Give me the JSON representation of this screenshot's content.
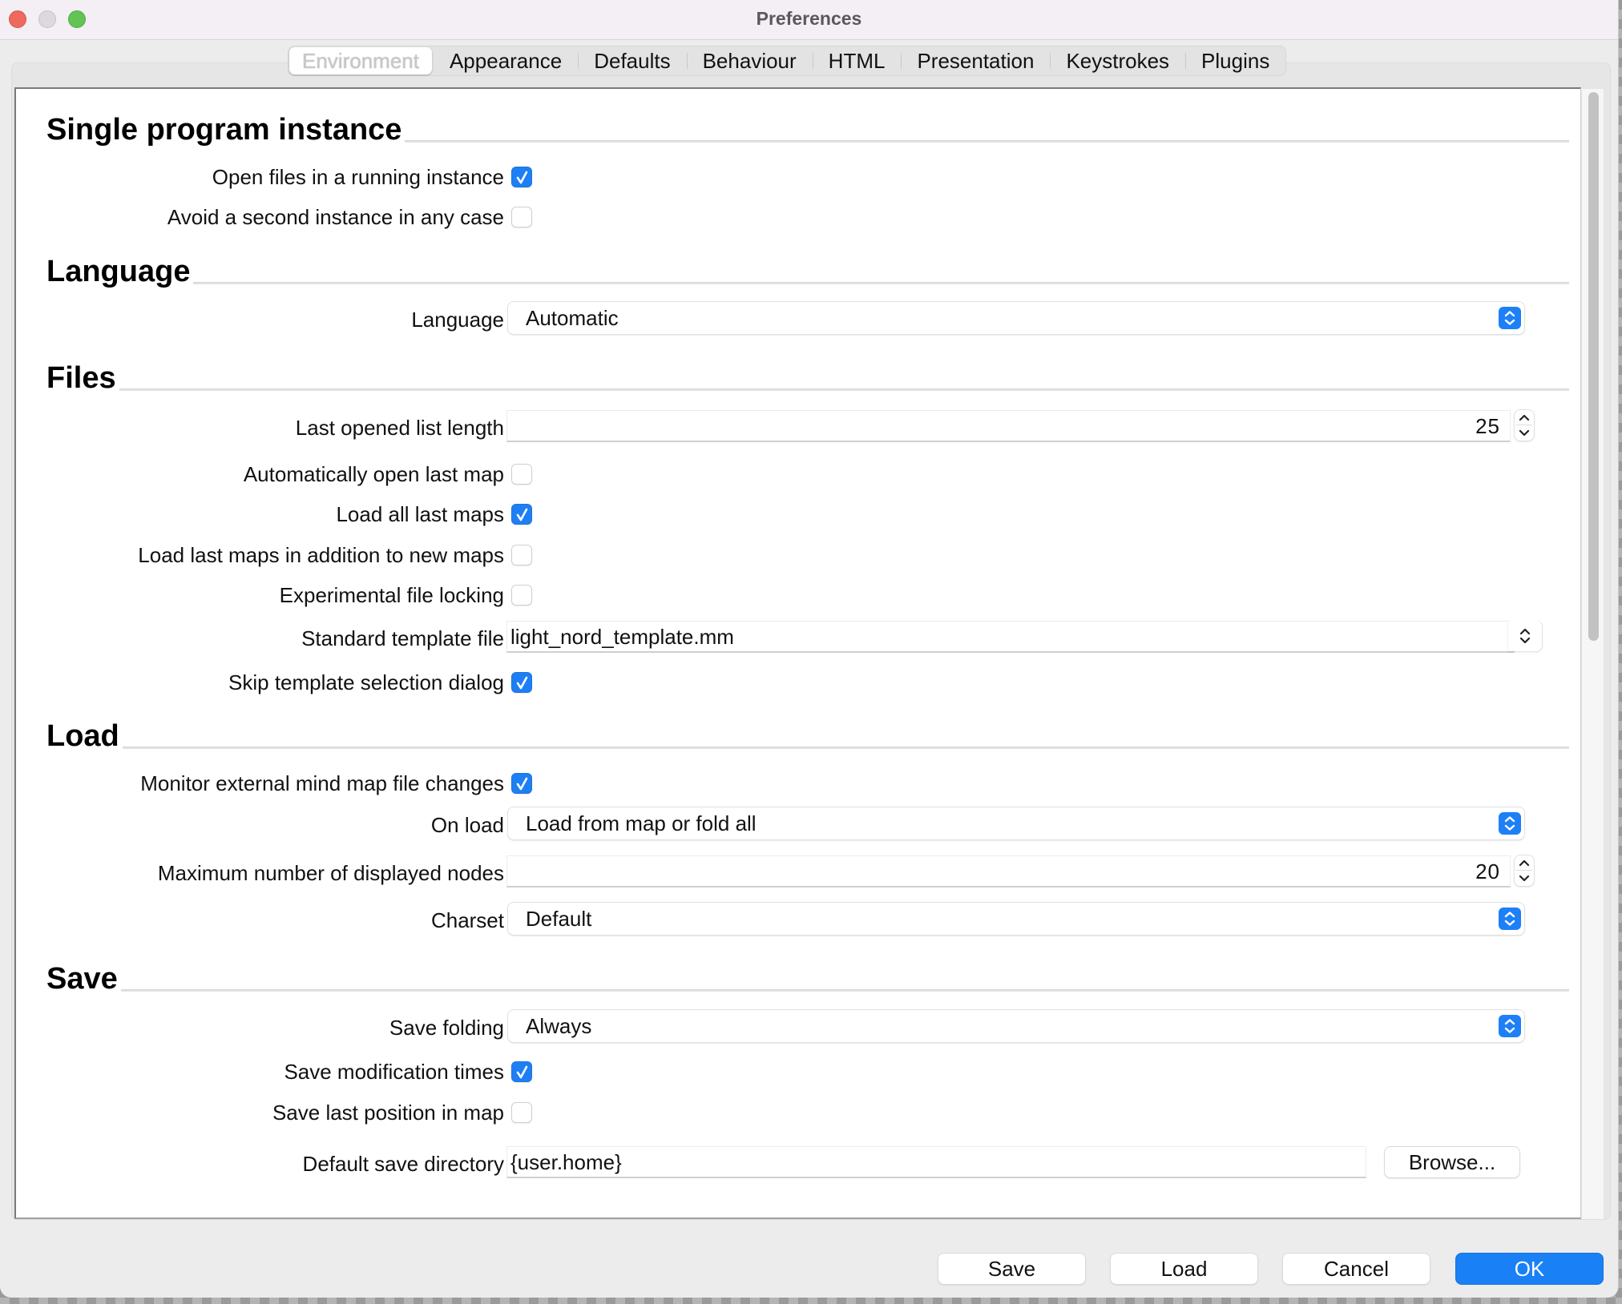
{
  "window": {
    "title": "Preferences"
  },
  "tabs": [
    {
      "label": "Environment",
      "active": true
    },
    {
      "label": "Appearance"
    },
    {
      "label": "Defaults"
    },
    {
      "label": "Behaviour"
    },
    {
      "label": "HTML"
    },
    {
      "label": "Presentation"
    },
    {
      "label": "Keystrokes"
    },
    {
      "label": "Plugins"
    }
  ],
  "sections": {
    "single_instance": {
      "title": "Single program instance",
      "open_files_running": {
        "label": "Open files in a running instance",
        "checked": true
      },
      "avoid_second": {
        "label": "Avoid a second instance in any case",
        "checked": false
      }
    },
    "language": {
      "title": "Language",
      "language": {
        "label": "Language",
        "value": "Automatic"
      }
    },
    "files": {
      "title": "Files",
      "last_opened_length": {
        "label": "Last opened list length",
        "value": "25"
      },
      "auto_open_last": {
        "label": "Automatically open last map",
        "checked": false
      },
      "load_all_last": {
        "label": "Load all last maps",
        "checked": true
      },
      "load_last_addition": {
        "label": "Load last maps in addition to new maps",
        "checked": false
      },
      "experimental_locking": {
        "label": "Experimental file locking",
        "checked": false
      },
      "standard_template": {
        "label": "Standard template file",
        "value": "light_nord_template.mm"
      },
      "skip_template_dialog": {
        "label": "Skip template selection dialog",
        "checked": true
      }
    },
    "load": {
      "title": "Load",
      "monitor_changes": {
        "label": "Monitor external mind map file changes",
        "checked": true
      },
      "on_load": {
        "label": "On load",
        "value": "Load from map or fold all"
      },
      "max_nodes": {
        "label": "Maximum number of displayed nodes",
        "value": "20"
      },
      "charset": {
        "label": "Charset",
        "value": "Default"
      }
    },
    "save": {
      "title": "Save",
      "save_folding": {
        "label": "Save folding",
        "value": "Always"
      },
      "save_mod_times": {
        "label": "Save modification times",
        "checked": true
      },
      "save_last_position": {
        "label": "Save last position in map",
        "checked": false
      },
      "default_dir": {
        "label": "Default save directory",
        "value": "{user.home}",
        "browse_label": "Browse..."
      }
    }
  },
  "footer": {
    "save_label": "Save",
    "load_label": "Load",
    "cancel_label": "Cancel",
    "ok_label": "OK"
  },
  "colors": {
    "accent": "#1e80f7",
    "checkbox_checked": "#1e7ff5"
  }
}
